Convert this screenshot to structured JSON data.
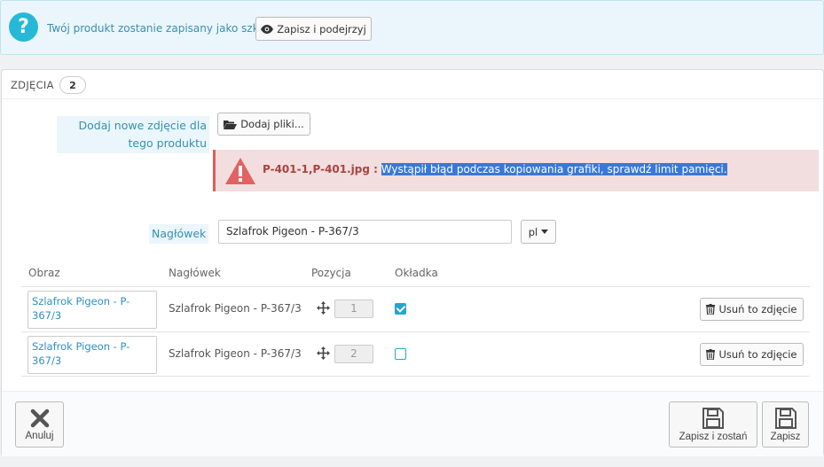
{
  "draft": {
    "message": "Twój produkt zostanie zapisany jako szkic",
    "preview_label": "Zapisz i podejrzyj"
  },
  "images_panel": {
    "title": "ZDJĘCIA",
    "count": "2",
    "add_label": "Dodaj nowe zdjęcie dla tego produktu",
    "add_files_label": "Dodaj pliki...",
    "error": {
      "files": "P-401-1,P-401.jpg :",
      "message": "Wystąpił błąd podczas kopiowania grafiki, sprawdź limit pamięci."
    },
    "heading_label": "Nagłówek",
    "heading_value": "Szlafrok Pigeon - P-367/3",
    "language": "pl",
    "table": {
      "columns": [
        "Obraz",
        "Nagłówek",
        "Pozycja",
        "Okładka"
      ],
      "rows": [
        {
          "image_alt": "Szlafrok Pigeon - P-367/3",
          "heading": "Szlafrok Pigeon - P-367/3",
          "position": "1",
          "cover": true,
          "delete_label": "Usuń to zdjęcie"
        },
        {
          "image_alt": "Szlafrok Pigeon - P-367/3",
          "heading": "Szlafrok Pigeon - P-367/3",
          "position": "2",
          "cover": false,
          "delete_label": "Usuń to zdjęcie"
        }
      ]
    }
  },
  "footer": {
    "cancel_label": "Anuluj",
    "save_stay_label": "Zapisz i zostań",
    "save_label": "Zapisz"
  },
  "colors": {
    "accent": "#25b9d7",
    "error_bg": "#f2dede",
    "error_text": "#a94442"
  }
}
